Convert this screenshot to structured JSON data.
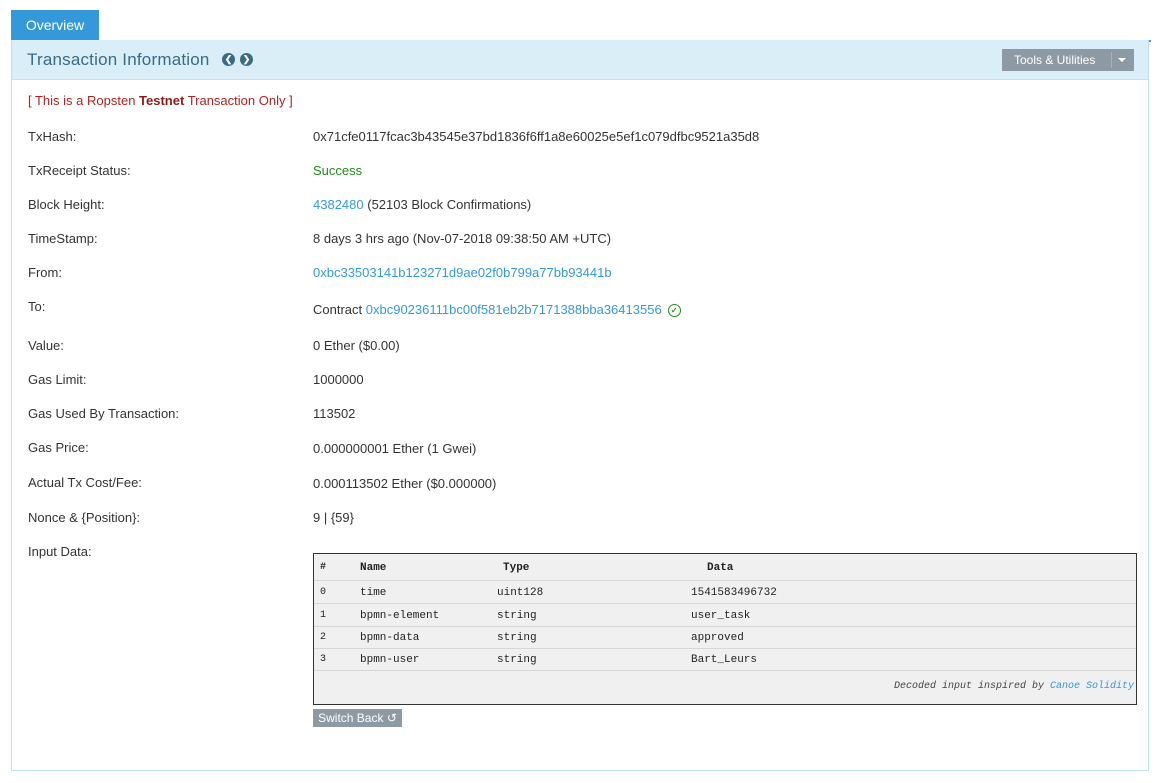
{
  "tabs": {
    "overview": "Overview"
  },
  "header": {
    "title": "Transaction Information",
    "prev_glyph": "❮",
    "next_glyph": "❯",
    "tools_label": "Tools & Utilities"
  },
  "notice": {
    "prefix": "[ This is a Ropsten ",
    "strong": "Testnet",
    "suffix": " Transaction Only ]"
  },
  "fields": {
    "txhash": {
      "label": "TxHash:",
      "value": "0x71cfe0117fcac3b43545e37bd1836f6ff1a8e60025e5ef1c079dfbc9521a35d8"
    },
    "status": {
      "label": "TxReceipt Status:",
      "value": "Success"
    },
    "block": {
      "label": "Block Height:",
      "link": "4382480",
      "rest": " (52103 Block Confirmations)"
    },
    "timestamp": {
      "label": "TimeStamp:",
      "value": "8 days 3 hrs ago (Nov-07-2018 09:38:50 AM +UTC)"
    },
    "from": {
      "label": "From:",
      "value": "0xbc33503141b123271d9ae02f0b799a77bb93441b"
    },
    "to": {
      "label": "To:",
      "prefix": "Contract ",
      "value": "0xbc90236111bc00f581eb2b7171388bba36413556",
      "check_glyph": "✓"
    },
    "value": {
      "label": "Value:",
      "value": "0 Ether ($0.00)"
    },
    "gas_limit": {
      "label": "Gas Limit:",
      "value": "1000000"
    },
    "gas_used": {
      "label": "Gas Used By Transaction:",
      "value": "113502"
    },
    "gas_price": {
      "label": "Gas Price:",
      "value": "0.000000001 Ether (1 Gwei)"
    },
    "fee": {
      "label": "Actual Tx Cost/Fee:",
      "value": "0.000113502 Ether ($0.000000)"
    },
    "nonce": {
      "label": "Nonce & {Position}:",
      "value": "9 | {59}"
    },
    "input": {
      "label": "Input Data:"
    }
  },
  "input_table": {
    "headers": [
      "#",
      "Name",
      "Type",
      "Data"
    ],
    "rows": [
      [
        "0",
        "time",
        "uint128",
        "1541583496732"
      ],
      [
        "1",
        "bpmn-element",
        "string",
        "user_task"
      ],
      [
        "2",
        "bpmn-data",
        "string",
        "approved"
      ],
      [
        "3",
        "bpmn-user",
        "string",
        "Bart_Leurs"
      ]
    ],
    "footer_text": "Decoded input inspired by ",
    "footer_link": "Canoe Solidity"
  },
  "switch_back": "Switch Back ↺"
}
